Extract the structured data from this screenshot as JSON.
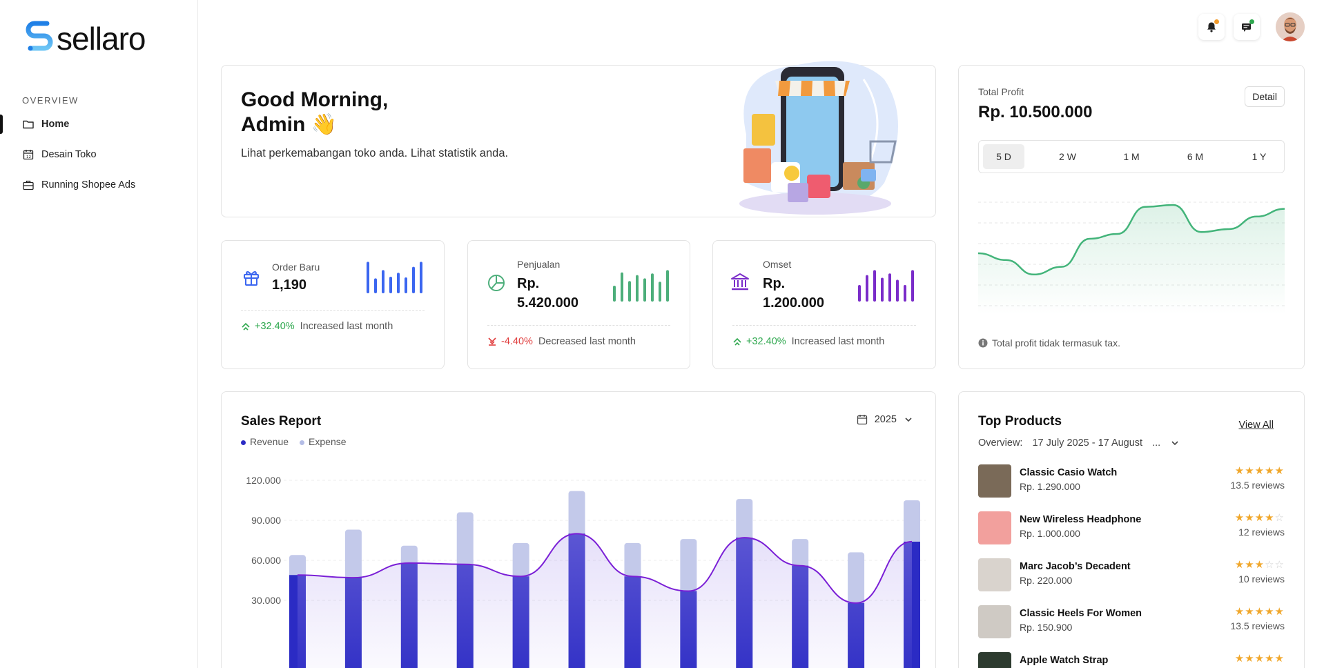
{
  "brand": {
    "name": "sellaro"
  },
  "sidebar": {
    "section": "OVERVIEW",
    "items": [
      {
        "label": "Home",
        "icon": "folder-icon",
        "active": true
      },
      {
        "label": "Desain Toko",
        "icon": "calendar-icon",
        "active": false
      },
      {
        "label": "Running Shopee Ads",
        "icon": "briefcase-icon",
        "active": false
      }
    ]
  },
  "header": {
    "notification_dot": "#f29b2c",
    "message_dot": "#2fa84f"
  },
  "greeting": {
    "line1": "Good Morning,",
    "line2": "Admin 👋",
    "subtitle": "Lihat perkemabangan toko anda. Lihat statistik anda."
  },
  "stats": [
    {
      "label": "Order Baru",
      "value": "1,190",
      "value_line2": "",
      "change": "+32.40%",
      "direction": "up",
      "note": "Increased last month",
      "color": "#3b66f0",
      "icon": "gift-icon",
      "bars": [
        0.95,
        0.45,
        0.7,
        0.5,
        0.62,
        0.48,
        0.8,
        0.95
      ]
    },
    {
      "label": "Penjualan",
      "value": "Rp.",
      "value_line2": "5.420.000",
      "change": "-4.40%",
      "direction": "down",
      "note": "Decreased last month",
      "color": "#4cae7a",
      "icon": "pie-chart-icon",
      "bars": [
        0.48,
        0.88,
        0.62,
        0.8,
        0.7,
        0.85,
        0.6,
        0.95
      ]
    },
    {
      "label": "Omset",
      "value": "Rp.",
      "value_line2": "1.200.000",
      "change": "+32.40%",
      "direction": "up",
      "note": "Increased last month",
      "color": "#7a2cc9",
      "icon": "bank-icon",
      "bars": [
        0.5,
        0.8,
        0.95,
        0.72,
        0.85,
        0.66,
        0.5,
        0.95
      ]
    }
  ],
  "profit": {
    "label": "Total Profit",
    "value": "Rp. 10.500.000",
    "detail": "Detail",
    "ranges": [
      "5 D",
      "2 W",
      "1 M",
      "6 M",
      "1 Y"
    ],
    "active_range": "5 D",
    "note": "Total profit tidak termasuk tax.",
    "curve": [
      0.4,
      0.33,
      0.18,
      0.26,
      0.55,
      0.6,
      0.88,
      0.9,
      0.62,
      0.65,
      0.78,
      0.86
    ]
  },
  "sales_report": {
    "title": "Sales Report",
    "year": "2025",
    "legend": [
      {
        "name": "Revenue",
        "color": "#2b2bc4"
      },
      {
        "name": "Expense",
        "color": "#b4bde6"
      }
    ]
  },
  "chart_data": {
    "type": "bar",
    "y_ticks": [
      "120.000",
      "90.000",
      "60.000",
      "30.000"
    ],
    "ylim": [
      0,
      120000
    ],
    "series": [
      {
        "name": "Revenue",
        "values": [
          49000,
          47000,
          58000,
          57000,
          48000,
          80000,
          48000,
          37000,
          77000,
          56000,
          28000,
          74000
        ]
      },
      {
        "name": "Expense",
        "values": [
          64000,
          83000,
          71000,
          96000,
          73000,
          112000,
          73000,
          76000,
          106000,
          76000,
          66000,
          105000
        ]
      }
    ],
    "line": [
      49000,
      47000,
      58000,
      57000,
      48000,
      80000,
      48000,
      37000,
      77000,
      56000,
      28000,
      74000
    ]
  },
  "top_products": {
    "title": "Top Products",
    "view_all": "View All",
    "overview_label": "Overview:",
    "overview_range": "17 July 2025 - 17 August",
    "overview_more": "...",
    "items": [
      {
        "name": "Classic Casio Watch",
        "price": "Rp. 1.290.000",
        "rating": 5,
        "reviews": "13.5 reviews",
        "thumb_color": "#7a6a58"
      },
      {
        "name": "New Wireless Headphone",
        "price": "Rp. 1.000.000",
        "rating": 4,
        "reviews": "12 reviews",
        "thumb_color": "#f2a09d"
      },
      {
        "name": "Marc Jacob’s Decadent",
        "price": "Rp. 220.000",
        "rating": 3,
        "reviews": "10 reviews",
        "thumb_color": "#d9d3cd"
      },
      {
        "name": "Classic Heels For Women",
        "price": "Rp. 150.900",
        "rating": 5,
        "reviews": "13.5 reviews",
        "thumb_color": "#cfcac4"
      },
      {
        "name": "Apple Watch Strap",
        "price": "",
        "rating": 5,
        "reviews": "",
        "thumb_color": "#2d3b2f"
      }
    ]
  }
}
